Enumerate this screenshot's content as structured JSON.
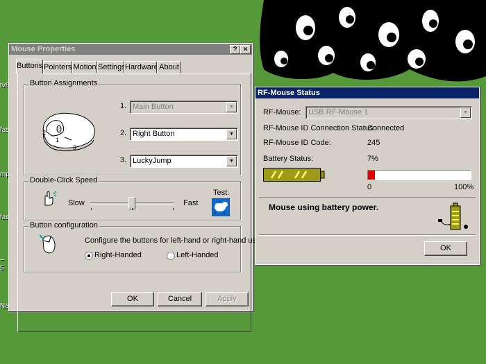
{
  "desktop": {
    "icon_labels": [
      "tv8",
      "fas",
      "mp",
      "fas",
      "~",
      "5",
      "Ne"
    ]
  },
  "mouse_properties": {
    "title": "Mouse Properties",
    "help_btn": "?",
    "close_btn": "×",
    "tabs": [
      "Buttons",
      "Pointers",
      "Motion",
      "Settings",
      "Hardware",
      "About"
    ],
    "selected_tab": "Buttons",
    "button_assignments": {
      "label": "Button Assignments",
      "rows": [
        {
          "num": "1.",
          "value": "Main Button",
          "enabled": false
        },
        {
          "num": "2.",
          "value": "Right Button",
          "enabled": true
        },
        {
          "num": "3.",
          "value": "LuckyJump",
          "enabled": true
        }
      ],
      "mouse_numbers": [
        "2",
        "1",
        "3"
      ]
    },
    "double_click": {
      "label": "Double-Click Speed",
      "slow": "Slow",
      "fast": "Fast",
      "test": "Test:",
      "level": 0.5
    },
    "button_config": {
      "label": "Button configuration",
      "description": "Configure the buttons for left-hand or right-hand use.",
      "right_handed": "Right-Handed",
      "left_handed": "Left-Handed",
      "selected": "right"
    },
    "buttons": {
      "ok": "OK",
      "cancel": "Cancel",
      "apply": "Apply"
    }
  },
  "rf_status": {
    "title": "RF-Mouse Status",
    "rf_mouse_label": "RF-Mouse:",
    "rf_mouse_value": "USB RF-Mouse 1",
    "conn_label": "RF-Mouse ID Connection Status:",
    "conn_value": "Connected",
    "code_label": "RF-Mouse ID Code:",
    "code_value": "245",
    "battery_label": "Battery Status:",
    "battery_value": "7%",
    "battery_level": 0.07,
    "scale_min": "0",
    "scale_max": "100%",
    "power_message": "Mouse using battery power.",
    "ok": "OK"
  }
}
